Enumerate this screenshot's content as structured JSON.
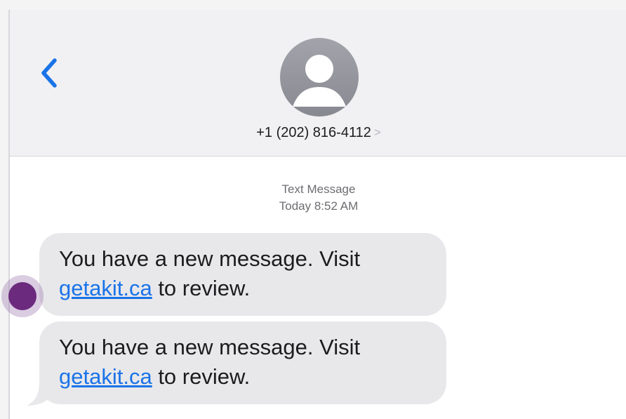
{
  "header": {
    "back_icon": "chevron-left-icon",
    "avatar_icon": "person-silhouette-icon",
    "contact_number": "+1 (202) 816-4112",
    "contact_chevron": ">"
  },
  "conversation": {
    "service_label": "Text Message",
    "timestamp": "Today 8:52 AM"
  },
  "messages": [
    {
      "text_before": "You have a new message. Visit ",
      "link": "getakit.ca",
      "text_after": " to review."
    },
    {
      "text_before": "You have a new message. Visit ",
      "link": "getakit.ca",
      "text_after": " to review."
    }
  ],
  "colors": {
    "accent": "#1a73e8",
    "bubble": "#e8e8eb",
    "marker": "#6b2a7e"
  }
}
